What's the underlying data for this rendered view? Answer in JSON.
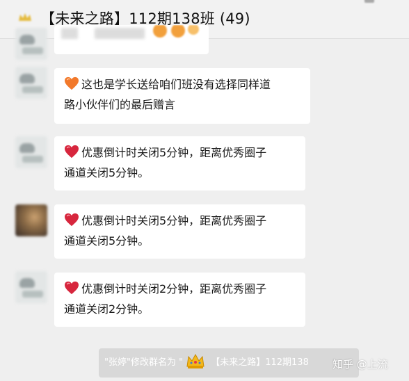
{
  "header": {
    "crown_icon": "crown-icon",
    "title": "【未来之路】112期138班 (49)"
  },
  "messages": [
    {
      "avatar": "avatar-icon",
      "icon": "emoji-icon",
      "text_lines": []
    },
    {
      "avatar": "avatar-icon",
      "icon": "orange-heart-icon",
      "text_lines": [
        "这也是学长送给咱们班没有选择同样道",
        "路小伙伴们的最后赠言"
      ]
    },
    {
      "avatar": "avatar-icon",
      "icon": "red-heart-icon",
      "text_lines": [
        "优惠倒计时关闭5分钟，距离优秀圈子",
        "通道关闭5分钟。"
      ]
    },
    {
      "avatar": "avatar-icon",
      "icon": "red-heart-icon",
      "text_lines": [
        "优惠倒计时关闭5分钟，距离优秀圈子",
        "通道关闭5分钟。"
      ]
    },
    {
      "avatar": "avatar-icon",
      "icon": "red-heart-icon",
      "text_lines": [
        "优惠倒计时关闭2分钟，距离优秀圈子",
        "通道关闭2分钟。"
      ]
    }
  ],
  "system_notice": {
    "prefix": "\"张婷\"修改群名为 \"",
    "crown_icon": "crown-icon",
    "suffix": " 【未来之路】112期138"
  },
  "watermark": "知乎 @上流",
  "colors": {
    "background": "#efefef",
    "bubble": "#ffffff",
    "red_heart": "#d7263d",
    "orange_heart": "#f2792b",
    "crown_gold": "#f3b81c"
  }
}
